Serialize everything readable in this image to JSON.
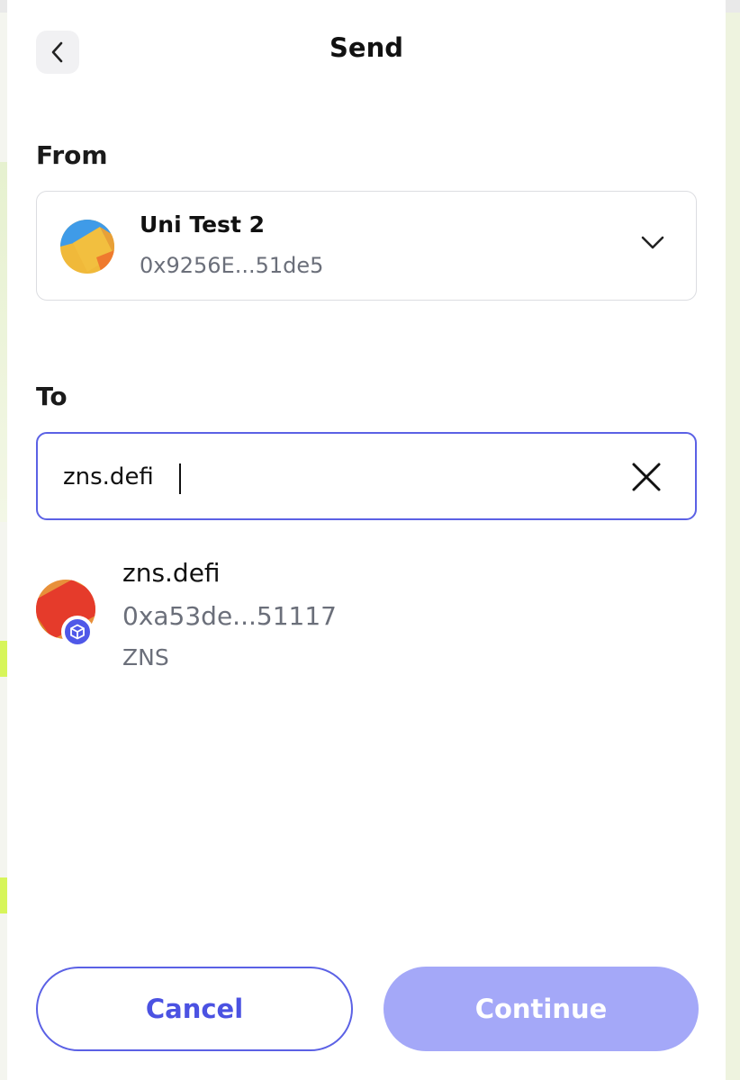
{
  "header": {
    "title": "Send"
  },
  "from": {
    "label": "From",
    "account_name": "Uni Test 2",
    "account_address": "0x9256E...51de5"
  },
  "to": {
    "label": "To",
    "input_value": "zns.defi"
  },
  "result": {
    "name": "zns.defi",
    "address": "0xa53de...51117",
    "tag": "ZNS"
  },
  "actions": {
    "cancel_label": "Cancel",
    "continue_label": "Continue"
  },
  "colors": {
    "accent": "#5b61e5",
    "continue_disabled": "#a4a8f8"
  }
}
